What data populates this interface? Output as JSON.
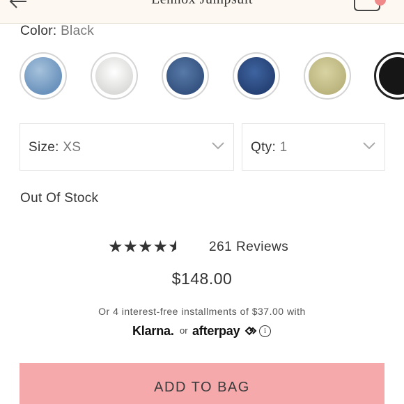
{
  "header": {
    "title": "Lennox Jumpsuit",
    "back_icon": "arrow-left-icon",
    "bag_icon": "shopping-bag-icon"
  },
  "color": {
    "label": "Color:",
    "value": "Black",
    "swatches": [
      {
        "name": "Light Wash Denim",
        "color": "#7fa4c8"
      },
      {
        "name": "White",
        "color": "#e8e8e6"
      },
      {
        "name": "Medium Denim",
        "color": "#3f5f8f"
      },
      {
        "name": "Dark Denim",
        "color": "#2d4e86"
      },
      {
        "name": "Khaki",
        "color": "#c9c28e"
      },
      {
        "name": "Black",
        "color": "#161616",
        "selected": true
      }
    ]
  },
  "size": {
    "label": "Size:",
    "value": "XS"
  },
  "qty": {
    "label": "Qty:",
    "value": "1"
  },
  "stock_status": "Out Of Stock",
  "rating": {
    "stars": 4.5,
    "reviews_label": "261 Reviews"
  },
  "price": "$148.00",
  "installments": {
    "text": "Or 4 interest-free installments of $37.00 with",
    "klarna": "Klarna.",
    "or": "or",
    "afterpay": "afterpay",
    "info_icon": "info-icon"
  },
  "add_to_bag": "ADD TO BAG",
  "colors": {
    "button": "#f5a9ab",
    "header_bg": "#fdf9f2",
    "badge": "#f08a8a"
  }
}
